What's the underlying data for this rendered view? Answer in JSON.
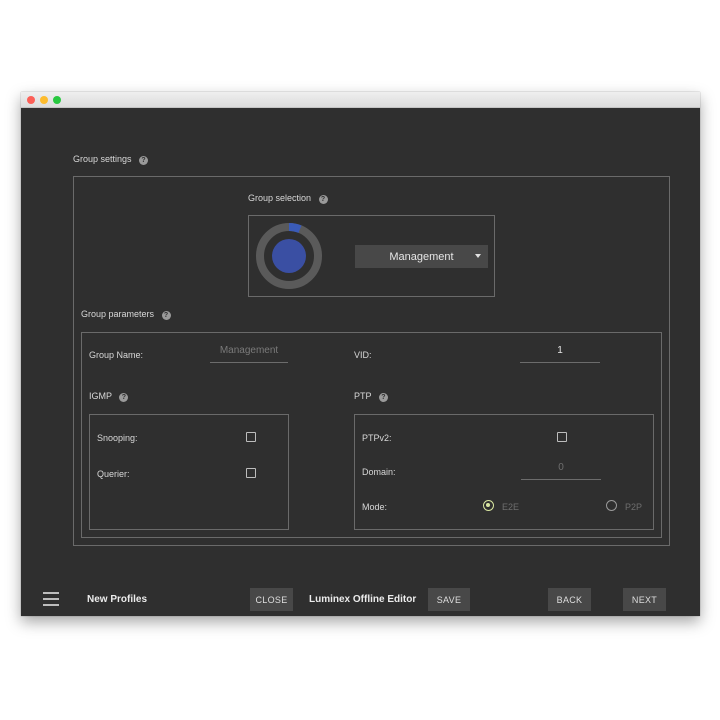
{
  "group_settings": {
    "title": "Group settings"
  },
  "group_selection": {
    "title": "Group selection",
    "selected": "Management"
  },
  "group_parameters": {
    "title": "Group parameters",
    "group_name_label": "Group Name:",
    "group_name_placeholder": "Management",
    "vid_label": "VID:",
    "vid_value": "1"
  },
  "igmp": {
    "title": "IGMP",
    "snooping_label": "Snooping:",
    "querier_label": "Querier:"
  },
  "ptp": {
    "title": "PTP",
    "ptpv2_label": "PTPv2:",
    "domain_label": "Domain:",
    "domain_value": "0",
    "mode_label": "Mode:",
    "mode_options": [
      "E2E",
      "P2P"
    ],
    "mode_selected": "E2E"
  },
  "footer": {
    "profile_name": "New Profiles",
    "close_label": "CLOSE",
    "app_title": "Luminex Offline Editor",
    "save_label": "SAVE",
    "back_label": "BACK",
    "next_label": "NEXT"
  },
  "colors": {
    "window_bg": "#2f2f2f",
    "accent_blue": "#3a4fa3",
    "radio_selected": "#d8e6a0"
  }
}
